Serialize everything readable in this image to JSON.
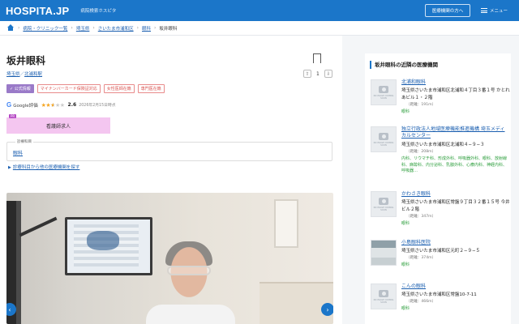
{
  "header": {
    "logo": "HOSPITA.JP",
    "tagline": "病院検索ホスピタ",
    "search_button": "医療機関の方へ",
    "menu_label": "メニュー"
  },
  "breadcrumb": [
    "病院・クリニック一覧",
    "埼玉県",
    "さいたま市浦和区",
    "眼科",
    "坂井眼科"
  ],
  "clinic": {
    "name": "坂井眼科",
    "prefecture": "埼玉県",
    "station": "北浦和駅",
    "vote_count": "1",
    "tags": [
      "公式情報",
      "マイナンバーカード保険証対応",
      "女性医師在籍",
      "専門医在籍"
    ],
    "rating_source": "Google評価",
    "rating": 2.6,
    "rating_value": "2.6",
    "rating_date": "2026年2月15日時点",
    "job_pr": "PR",
    "job_label": "看護師求人",
    "dept_label": "診療科目",
    "dept": "眼科",
    "other_link": "診療科目から他の医療機関を探す"
  },
  "sidebar": {
    "title": "坂井眼科の近隣の医療機関",
    "no_image": "NO IMAGE COMING SOON",
    "items": [
      {
        "name": "北浦和眼科",
        "address": "埼玉県さいたま市浦和区北浦和４丁目３番１号 かとれあビル１・２階",
        "distance": "（距離：191m）",
        "depts": "眼科"
      },
      {
        "name": "独立行政法人地域医療機能推進機構 埼玉メディカルセンター",
        "address": "埼玉県さいたま市浦和区北浦和４−９−３",
        "distance": "（距離：208m）",
        "depts": "内科、リウマチ科、形成外科、呼吸器外科、眼科、放射線科、麻酔科、内分泌科、乳腺外科、心療内科、神経内科、呼吸器…"
      },
      {
        "name": "かわさき眼科",
        "address": "埼玉県さいたま市浦和区常盤９丁目３２番１５号 今井ビル２階",
        "distance": "（距離：347m）",
        "depts": "眼科"
      },
      {
        "name": "小島眼科医院",
        "address": "埼玉県さいたま市浦和区元町２−９−５",
        "distance": "（距離：374m）",
        "depts": "眼科"
      },
      {
        "name": "こんの眼科",
        "address": "埼玉県さいたま市浦和区常盤10-7-11",
        "distance": "（距離：466m）",
        "depts": "眼科"
      }
    ]
  },
  "colors": {
    "brand": "#1b76c9",
    "link": "#1b5fb0",
    "tag": "#d9534f",
    "dept_green": "#2a9d3a",
    "job_bg": "#f4c6f0"
  }
}
